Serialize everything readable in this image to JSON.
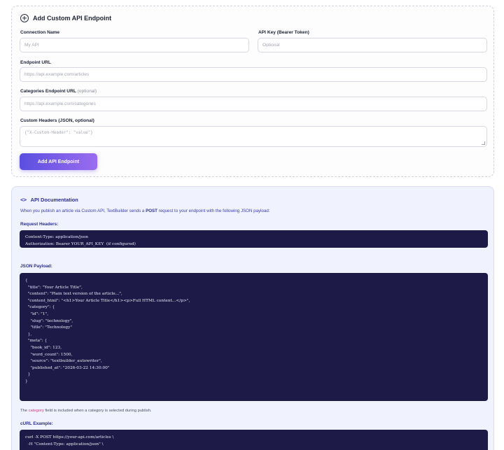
{
  "form": {
    "title": "Add Custom API Endpoint",
    "connection_name": {
      "label": "Connection Name",
      "placeholder": "My API"
    },
    "api_key": {
      "label": "API Key (Bearer Token)",
      "placeholder": "Optional"
    },
    "endpoint_url": {
      "label": "Endpoint URL",
      "placeholder": "https://api.example.com/articles"
    },
    "categories_url": {
      "label": "Categories Endpoint URL",
      "optional": "(optional)",
      "placeholder": "https://api.example.com/categories"
    },
    "custom_headers": {
      "label": "Custom Headers (JSON, optional)",
      "placeholder": "{\"X-Custom-Header\": \"value\"}"
    },
    "submit_label": "Add API Endpoint"
  },
  "docs": {
    "title": "API Documentation",
    "intro_before": "When you publish an article via Custom API, TextBuilder sends a ",
    "intro_method": "POST",
    "intro_after": " request to your endpoint with the following JSON payload:",
    "request_headers_label": "Request Headers:",
    "request_headers_code": "Content-Type: application/json\nAuthorization: Bearer YOUR_API_KEY  (if configured)",
    "json_payload_label": "JSON Payload:",
    "json_payload_code": "{\n  \"title\": \"Your Article Title\",\n  \"content\": \"Plain text version of the article...\",\n  \"content_html\": \"<h1>Your Article Title</h1><p>Full HTML content...</p>\",\n  \"category\": {\n    \"id\": \"1\",\n    \"slug\": \"technology\",\n    \"title\": \"Technology\"\n  },\n  \"meta\": {\n    \"book_id\": 123,\n    \"word_count\": 1500,\n    \"source\": \"textbuilder_autowriter\",\n    \"published_at\": \"2026-03-22 14:30:00\"\n  }\n}",
    "note_before": "The ",
    "note_highlight": "category",
    "note_after": " field is included when a category is selected during publish.",
    "curl_label": "cURL Example:",
    "curl_code": "curl -X POST https://your-api.com/articles \\\n  -H \"Content-Type: application/json\" \\"
  },
  "icons": {
    "form_icon": "plus-circle-icon",
    "docs_icon": "code-brackets-icon"
  },
  "colors": {
    "button_gradient_start": "#5b4fe0",
    "button_gradient_end": "#9a6cf0",
    "code_background": "#1e1a48",
    "docs_background": "#f0f2fd",
    "highlight": "#d43a86"
  }
}
